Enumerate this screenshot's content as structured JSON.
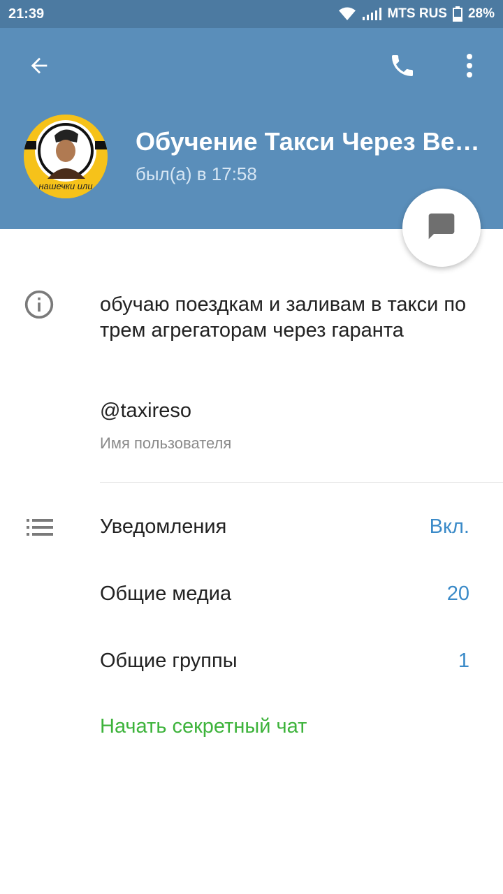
{
  "status_bar": {
    "time": "21:39",
    "carrier": "MTS RUS",
    "battery": "28%",
    "icons": [
      "wifi-icon",
      "signal-icon",
      "battery-icon"
    ]
  },
  "header": {
    "back_icon": "arrow-left-icon",
    "call_icon": "phone-icon",
    "menu_icon": "more-vertical-icon",
    "avatar_caption": "нашечки или",
    "title": "Обучение Такси Через Ве…",
    "subtitle": "был(а) в 17:58",
    "accent": "#5a8eba"
  },
  "fab": {
    "icon": "message-icon"
  },
  "info": {
    "icon": "info-icon",
    "about": "обучаю поездкам и заливам в такси по трем агрегаторам через гаранта",
    "username": "@taxireso",
    "username_label": "Имя пользователя"
  },
  "settings": {
    "icon": "list-icon",
    "rows": [
      {
        "label": "Уведомления",
        "value": "Вкл."
      },
      {
        "label": "Общие медиа",
        "value": "20"
      },
      {
        "label": "Общие группы",
        "value": "1"
      }
    ],
    "secret_chat": "Начать секретный чат",
    "secret_color": "#3db33b",
    "value_color": "#3a8ac8"
  }
}
